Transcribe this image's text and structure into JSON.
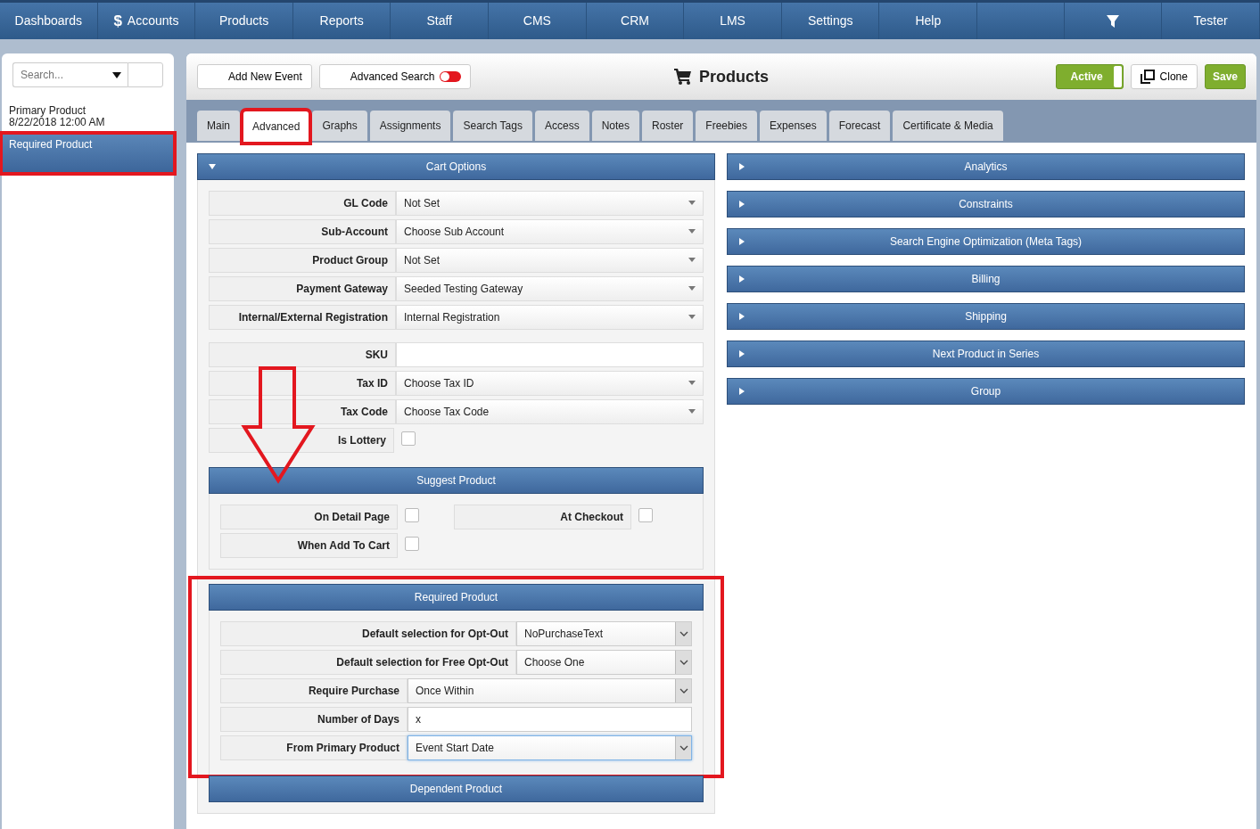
{
  "nav": [
    {
      "label": "Dashboards",
      "kind": "text"
    },
    {
      "label": "Accounts",
      "kind": "dollar",
      "icon_text": "$"
    },
    {
      "label": "Products",
      "kind": "text"
    },
    {
      "label": "Reports",
      "kind": "text"
    },
    {
      "label": "Staff",
      "kind": "text"
    },
    {
      "label": "CMS",
      "kind": "text"
    },
    {
      "label": "CRM",
      "kind": "text"
    },
    {
      "label": "LMS",
      "kind": "text"
    },
    {
      "label": "Settings",
      "kind": "text"
    },
    {
      "label": "Help",
      "kind": "text"
    },
    {
      "kind": "blank"
    },
    {
      "kind": "filter"
    },
    {
      "label": "Tester",
      "kind": "text"
    }
  ],
  "sidebar": {
    "search": {
      "placeholder": "Search..."
    },
    "items": [
      {
        "title": "Primary Product",
        "subtitle": "8/22/2018 12:00 AM",
        "selected": false,
        "highlighted": false
      },
      {
        "title": "Required Product",
        "selected": true,
        "highlighted": true
      }
    ]
  },
  "toolbar": {
    "add_button": "Add New Event",
    "advanced_search": {
      "label": "Advanced Search",
      "on": false
    },
    "title": "Products",
    "active_toggle": {
      "label": "Active",
      "on": true
    },
    "clone_button": "Clone",
    "save_button": "Save"
  },
  "tabs": [
    {
      "label": "Main",
      "selected": false,
      "highlighted": false
    },
    {
      "label": "Advanced",
      "selected": true,
      "highlighted": true
    },
    {
      "label": "Graphs",
      "selected": false,
      "highlighted": false
    },
    {
      "label": "Assignments",
      "selected": false,
      "highlighted": false
    },
    {
      "label": "Search Tags",
      "selected": false,
      "highlighted": false
    },
    {
      "label": "Access",
      "selected": false,
      "highlighted": false
    },
    {
      "label": "Notes",
      "selected": false,
      "highlighted": false
    },
    {
      "label": "Roster",
      "selected": false,
      "highlighted": false
    },
    {
      "label": "Freebies",
      "selected": false,
      "highlighted": false
    },
    {
      "label": "Expenses",
      "selected": false,
      "highlighted": false
    },
    {
      "label": "Forecast",
      "selected": false,
      "highlighted": false
    },
    {
      "label": "Certificate & Media",
      "selected": false,
      "highlighted": false
    }
  ],
  "cart_options": {
    "title": "Cart Options",
    "expanded": true,
    "field_groups": [
      [
        {
          "label": "GL Code",
          "kind": "select",
          "value": "Not Set"
        },
        {
          "label": "Sub-Account",
          "kind": "select",
          "value": "Choose Sub Account"
        },
        {
          "label": "Product Group",
          "kind": "select",
          "value": "Not Set"
        },
        {
          "label": "Payment Gateway",
          "kind": "select",
          "value": "Seeded Testing Gateway"
        },
        {
          "label": "Internal/External Registration",
          "kind": "select",
          "value": "Internal Registration"
        }
      ],
      [
        {
          "label": "SKU",
          "kind": "input"
        },
        {
          "label": "Tax ID",
          "kind": "select",
          "value": "Choose Tax ID"
        },
        {
          "label": "Tax Code",
          "kind": "select",
          "value": "Choose Tax Code"
        },
        {
          "label": "Is Lottery",
          "kind": "checkbox",
          "checked": false
        }
      ]
    ],
    "suggest_product": {
      "title": "Suggest Product",
      "checks": [
        {
          "label": "On Detail Page",
          "checked": false
        },
        {
          "label": "At Checkout",
          "checked": false
        },
        {
          "label": "When Add To Cart",
          "checked": false
        }
      ]
    },
    "required_product": {
      "title": "Required Product",
      "highlighted": true,
      "fields": [
        {
          "label": "Default selection for Opt-Out",
          "kind": "select",
          "wide_label": true,
          "value": "NoPurchaseText",
          "focused": false
        },
        {
          "label": "Default selection for Free Opt-Out",
          "kind": "select",
          "wide_label": true,
          "value": "Choose One",
          "focused": false
        },
        {
          "label": "Require Purchase",
          "kind": "select",
          "wide_label": false,
          "value": "Once Within",
          "focused": false
        },
        {
          "label": "Number of Days",
          "kind": "input",
          "wide_label": false,
          "value": "x",
          "focused": false
        },
        {
          "label": "From Primary Product",
          "kind": "select",
          "wide_label": false,
          "value": "Event Start Date",
          "focused": true
        }
      ]
    },
    "dependent_product": {
      "title": "Dependent Product"
    }
  },
  "panels": [
    {
      "title": "Analytics",
      "expanded": false
    },
    {
      "title": "Constraints",
      "expanded": false
    },
    {
      "title": "Search Engine Optimization (Meta Tags)",
      "expanded": false
    },
    {
      "title": "Billing",
      "expanded": false
    },
    {
      "title": "Shipping",
      "expanded": false
    },
    {
      "title": "Next Product in Series",
      "expanded": false
    },
    {
      "title": "Group",
      "expanded": false
    }
  ]
}
